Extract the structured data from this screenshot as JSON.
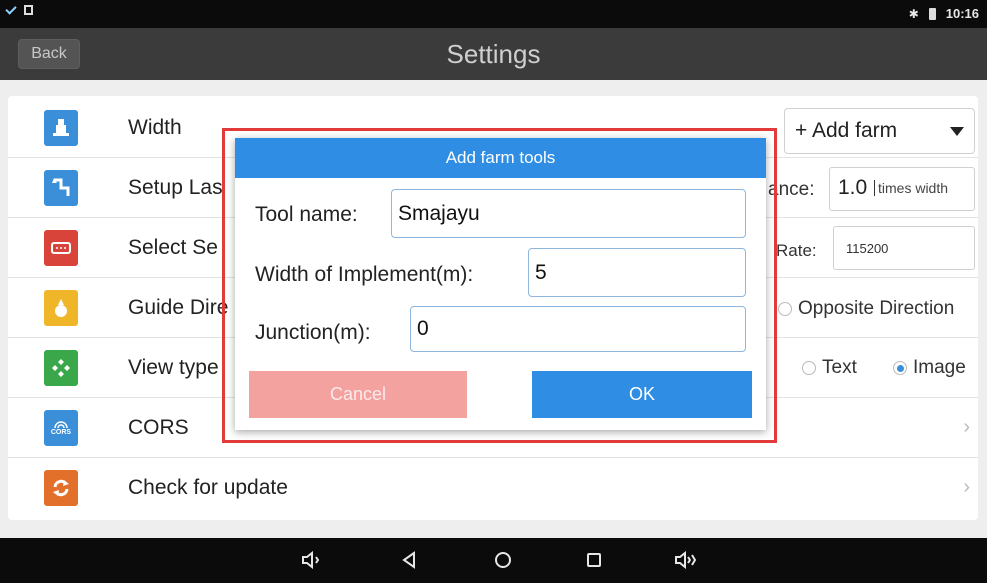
{
  "status_bar": {
    "time": "10:16",
    "icons": [
      "check-icon",
      "sdcard-icon",
      "bluetooth-icon",
      "battery-icon"
    ]
  },
  "header": {
    "back_label": "Back",
    "title": "Settings"
  },
  "settings": {
    "items": [
      {
        "label": "Width",
        "icon": "tractor-icon"
      },
      {
        "label": "Setup Las",
        "icon": "route-icon"
      },
      {
        "label": "Select Se",
        "icon": "serial-port-icon"
      },
      {
        "label": "Guide Dire",
        "icon": "guide-icon"
      },
      {
        "label": "View type",
        "icon": "view-icon"
      },
      {
        "label": "CORS",
        "icon": "cors-icon"
      },
      {
        "label": "Check for update",
        "icon": "update-icon"
      }
    ]
  },
  "background_controls": {
    "add_farm_label": "+ Add farm",
    "distance_label": "ance:",
    "distance_value": "1.0",
    "distance_unit": "times width",
    "rate_label": "Rate:",
    "rate_value": "115200",
    "opposite_label": "Opposite Direction",
    "view_text_label": "Text",
    "view_image_label": "Image"
  },
  "dialog": {
    "title": "Add farm tools",
    "tool_name_label": "Tool name:",
    "tool_name_value": "Smajayu",
    "width_label": "Width of Implement(m):",
    "width_value": "5",
    "junction_label": "Junction(m):",
    "junction_value": "0",
    "cancel_label": "Cancel",
    "ok_label": "OK"
  },
  "colors": {
    "accent": "#2f8ee4",
    "highlight": "#e23b3b",
    "cancel": "#f3a2a0"
  }
}
